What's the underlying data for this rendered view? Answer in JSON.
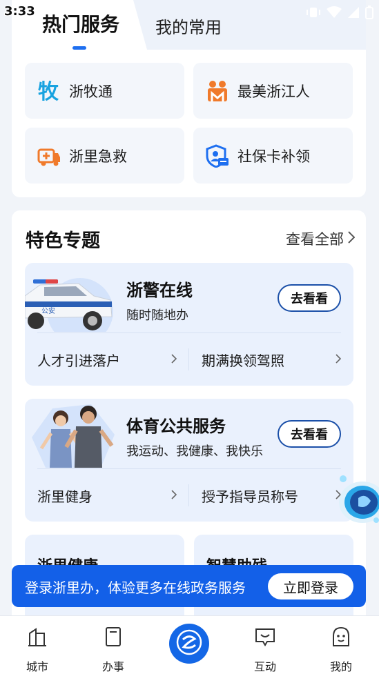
{
  "status_bar": {
    "time": "3:33"
  },
  "tabs": [
    {
      "label": "热门服务"
    },
    {
      "label": "我的常用"
    }
  ],
  "services": [
    {
      "label": "浙牧通",
      "icon": "ox-character-icon",
      "color": "#19a3e0"
    },
    {
      "label": "最美浙江人",
      "icon": "people-icon",
      "color": "#f07a2b"
    },
    {
      "label": "浙里急救",
      "icon": "ambulance-icon",
      "color": "#f07a2b"
    },
    {
      "label": "社保卡补领",
      "icon": "shield-card-icon",
      "color": "#1e6ff0"
    }
  ],
  "topics": {
    "title": "特色专题",
    "more_label": "查看全部",
    "features": [
      {
        "title": "浙警在线",
        "subtitle": "随时随地办",
        "button": "去看看",
        "links": [
          "人才引进落户",
          "期满换领驾照"
        ]
      },
      {
        "title": "体育公共服务",
        "subtitle": "我运动、我健康、我快乐",
        "button": "去看看",
        "links": [
          "浙里健身",
          "授予指导员称号"
        ]
      }
    ],
    "mini_cards": [
      {
        "title": "浙里健康"
      },
      {
        "title": "智慧助残"
      }
    ]
  },
  "login_banner": {
    "text": "登录浙里办，体验更多在线政务服务",
    "button": "立即登录"
  },
  "bottom_nav": [
    {
      "label": "城市"
    },
    {
      "label": "办事"
    },
    {
      "label": "互动"
    },
    {
      "label": "我的"
    }
  ],
  "colors": {
    "accent": "#1467e6",
    "banner": "#1360e8",
    "tile_bg": "#f3f6fb",
    "feature_bg": "#eaf1fd"
  }
}
